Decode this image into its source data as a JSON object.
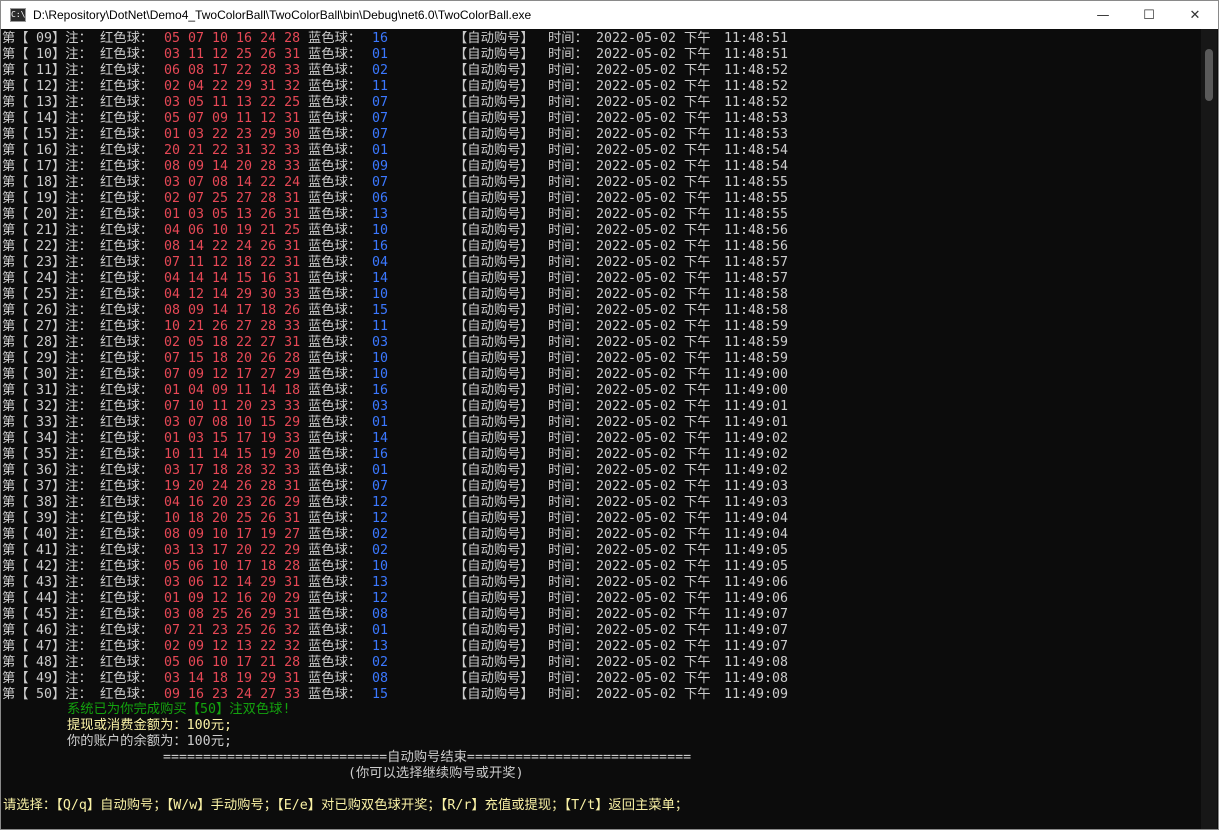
{
  "window": {
    "title": "D:\\Repository\\DotNet\\Demo4_TwoColorBall\\TwoColorBall\\bin\\Debug\\net6.0\\TwoColorBall.exe",
    "icon_text": "C:\\"
  },
  "controls": {
    "minimize": "—",
    "maximize": "☐",
    "close": "✕"
  },
  "labels": {
    "prefix": "第【",
    "bet": "】注：",
    "red": "红色球：",
    "blue": "蓝色球：",
    "auto": "【自动购号】",
    "time": "时间：",
    "date": "2022-05-02",
    "ampm": "下午"
  },
  "bets": [
    {
      "n": "09",
      "red": "05 07 10 16 24 28",
      "blue": "16",
      "time": "11:48:51"
    },
    {
      "n": "10",
      "red": "03 11 12 25 26 31",
      "blue": "01",
      "time": "11:48:51"
    },
    {
      "n": "11",
      "red": "06 08 17 22 28 33",
      "blue": "02",
      "time": "11:48:52"
    },
    {
      "n": "12",
      "red": "02 04 22 29 31 32",
      "blue": "11",
      "time": "11:48:52"
    },
    {
      "n": "13",
      "red": "03 05 11 13 22 25",
      "blue": "07",
      "time": "11:48:52"
    },
    {
      "n": "14",
      "red": "05 07 09 11 12 31",
      "blue": "07",
      "time": "11:48:53"
    },
    {
      "n": "15",
      "red": "01 03 22 23 29 30",
      "blue": "07",
      "time": "11:48:53"
    },
    {
      "n": "16",
      "red": "20 21 22 31 32 33",
      "blue": "01",
      "time": "11:48:54"
    },
    {
      "n": "17",
      "red": "08 09 14 20 28 33",
      "blue": "09",
      "time": "11:48:54"
    },
    {
      "n": "18",
      "red": "03 07 08 14 22 24",
      "blue": "07",
      "time": "11:48:55"
    },
    {
      "n": "19",
      "red": "02 07 25 27 28 31",
      "blue": "06",
      "time": "11:48:55"
    },
    {
      "n": "20",
      "red": "01 03 05 13 26 31",
      "blue": "13",
      "time": "11:48:55"
    },
    {
      "n": "21",
      "red": "04 06 10 19 21 25",
      "blue": "10",
      "time": "11:48:56"
    },
    {
      "n": "22",
      "red": "08 14 22 24 26 31",
      "blue": "16",
      "time": "11:48:56"
    },
    {
      "n": "23",
      "red": "07 11 12 18 22 31",
      "blue": "04",
      "time": "11:48:57"
    },
    {
      "n": "24",
      "red": "04 14 14 15 16 31",
      "blue": "14",
      "time": "11:48:57"
    },
    {
      "n": "25",
      "red": "04 12 14 29 30 33",
      "blue": "10",
      "time": "11:48:58"
    },
    {
      "n": "26",
      "red": "08 09 14 17 18 26",
      "blue": "15",
      "time": "11:48:58"
    },
    {
      "n": "27",
      "red": "10 21 26 27 28 33",
      "blue": "11",
      "time": "11:48:59"
    },
    {
      "n": "28",
      "red": "02 05 18 22 27 31",
      "blue": "03",
      "time": "11:48:59"
    },
    {
      "n": "29",
      "red": "07 15 18 20 26 28",
      "blue": "10",
      "time": "11:48:59"
    },
    {
      "n": "30",
      "red": "07 09 12 17 27 29",
      "blue": "10",
      "time": "11:49:00"
    },
    {
      "n": "31",
      "red": "01 04 09 11 14 18",
      "blue": "16",
      "time": "11:49:00"
    },
    {
      "n": "32",
      "red": "07 10 11 20 23 33",
      "blue": "03",
      "time": "11:49:01"
    },
    {
      "n": "33",
      "red": "03 07 08 10 15 29",
      "blue": "01",
      "time": "11:49:01"
    },
    {
      "n": "34",
      "red": "01 03 15 17 19 33",
      "blue": "14",
      "time": "11:49:02"
    },
    {
      "n": "35",
      "red": "10 11 14 15 19 20",
      "blue": "16",
      "time": "11:49:02"
    },
    {
      "n": "36",
      "red": "03 17 18 28 32 33",
      "blue": "01",
      "time": "11:49:02"
    },
    {
      "n": "37",
      "red": "19 20 24 26 28 31",
      "blue": "07",
      "time": "11:49:03"
    },
    {
      "n": "38",
      "red": "04 16 20 23 26 29",
      "blue": "12",
      "time": "11:49:03"
    },
    {
      "n": "39",
      "red": "10 18 20 25 26 31",
      "blue": "12",
      "time": "11:49:04"
    },
    {
      "n": "40",
      "red": "08 09 10 17 19 27",
      "blue": "02",
      "time": "11:49:04"
    },
    {
      "n": "41",
      "red": "03 13 17 20 22 29",
      "blue": "02",
      "time": "11:49:05"
    },
    {
      "n": "42",
      "red": "05 06 10 17 18 28",
      "blue": "10",
      "time": "11:49:05"
    },
    {
      "n": "43",
      "red": "03 06 12 14 29 31",
      "blue": "13",
      "time": "11:49:06"
    },
    {
      "n": "44",
      "red": "01 09 12 16 20 29",
      "blue": "12",
      "time": "11:49:06"
    },
    {
      "n": "45",
      "red": "03 08 25 26 29 31",
      "blue": "08",
      "time": "11:49:07"
    },
    {
      "n": "46",
      "red": "07 21 23 25 26 32",
      "blue": "01",
      "time": "11:49:07"
    },
    {
      "n": "47",
      "red": "02 09 12 13 22 32",
      "blue": "13",
      "time": "11:49:07"
    },
    {
      "n": "48",
      "red": "05 06 10 17 21 28",
      "blue": "02",
      "time": "11:49:08"
    },
    {
      "n": "49",
      "red": "03 14 18 19 29 31",
      "blue": "08",
      "time": "11:49:08"
    },
    {
      "n": "50",
      "red": "09 16 23 24 27 33",
      "blue": "15",
      "time": "11:49:09"
    }
  ],
  "summary": {
    "done": "系统已为你完成购买【50】注双色球!",
    "spent": "提现或消费金额为：100元;",
    "balance": "你的账户的余额为：100元;",
    "divider": "============================自动购号结束============================",
    "hint": "(你可以选择继续购号或开奖)"
  },
  "prompt": "请选择：【Q/q】自动购号；【W/w】手动购号；【E/e】对已购双色球开奖；【R/r】充值或提现；【T/t】返回主菜单；",
  "colors": {
    "white": "#cccccc",
    "red": "#e74856",
    "blue": "#3b78ff",
    "green": "#13a10e",
    "yellow": "#f9f1a5"
  }
}
